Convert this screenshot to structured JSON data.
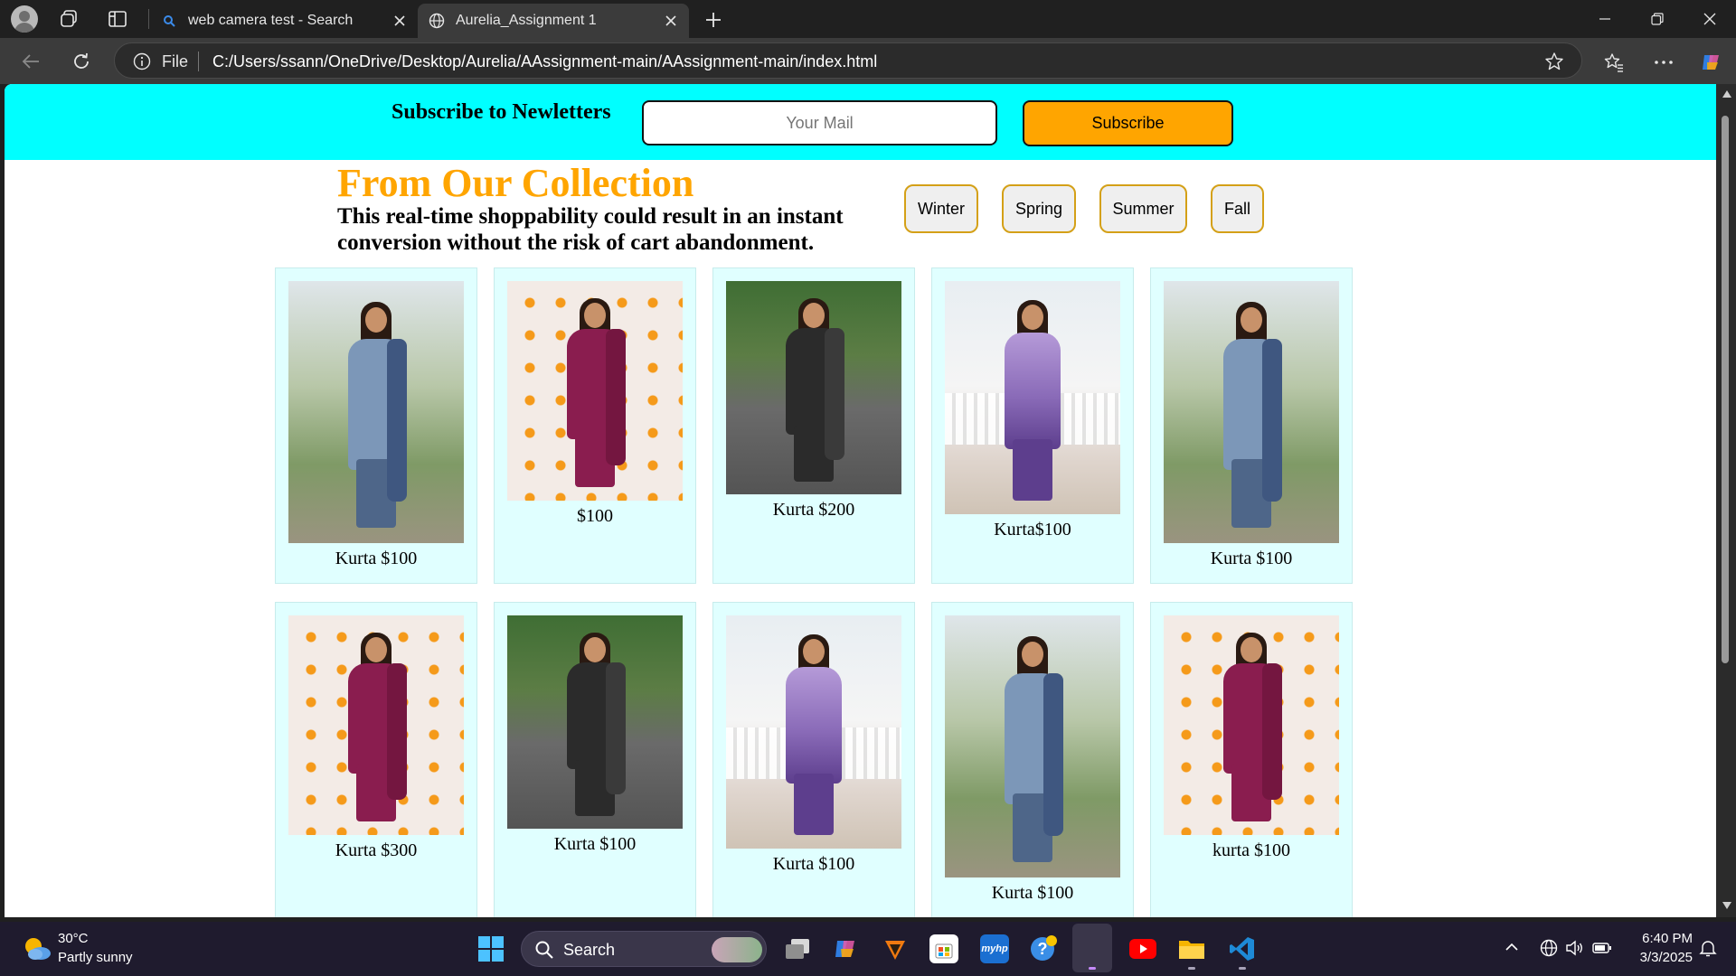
{
  "browser": {
    "tabs": [
      {
        "label": "web camera test - Search",
        "active": false,
        "icon": "search-icon"
      },
      {
        "label": "Aurelia_Assignment 1",
        "active": true,
        "icon": "globe-icon"
      }
    ],
    "address": {
      "scheme_label": "File",
      "url": "C:/Users/ssann/OneDrive/Desktop/Aurelia/AAssignment-main/AAssignment-main/index.html"
    }
  },
  "page": {
    "newsletter": {
      "title": "Subscribe to Newletters",
      "email_placeholder": "Your Mail",
      "button_label": "Subscribe",
      "background": "#00ffff",
      "button_color": "#ffa500"
    },
    "collection": {
      "title": "From Our Collection",
      "subtitle": "This real-time shoppability could result in an instant conversion without the risk of cart abandonment.",
      "title_color": "#ffa500"
    },
    "seasons": [
      "Winter",
      "Spring",
      "Summer",
      "Fall"
    ],
    "products": [
      {
        "caption": "Kurta $100",
        "style": "blue"
      },
      {
        "caption": "$100",
        "style": "wine"
      },
      {
        "caption": "Kurta $200",
        "style": "black"
      },
      {
        "caption": "Kurta$100",
        "style": "lavender"
      },
      {
        "caption": "Kurta $100",
        "style": "blue"
      },
      {
        "caption": "Kurta $300",
        "style": "wine"
      },
      {
        "caption": "Kurta $100",
        "style": "black"
      },
      {
        "caption": "Kurta $100",
        "style": "lavender"
      },
      {
        "caption": "Kurta $100",
        "style": "blue"
      },
      {
        "caption": "kurta $100",
        "style": "wine"
      }
    ]
  },
  "taskbar": {
    "weather": {
      "temp": "30°C",
      "desc": "Partly sunny"
    },
    "search_label": "Search",
    "clock": {
      "time": "6:40 PM",
      "date": "3/3/2025"
    }
  }
}
